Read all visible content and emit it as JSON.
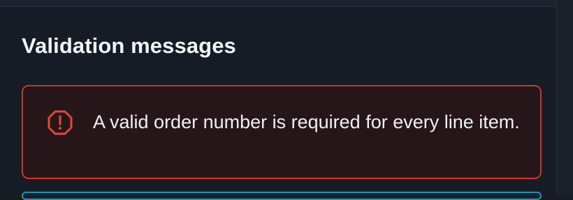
{
  "section": {
    "title": "Validation messages"
  },
  "alert": {
    "icon": "alert-octagon-icon",
    "message": "A valid order number is required for every line item.",
    "colors": {
      "border": "#c8372c",
      "background": "#261619",
      "icon": "#e0483a"
    }
  }
}
